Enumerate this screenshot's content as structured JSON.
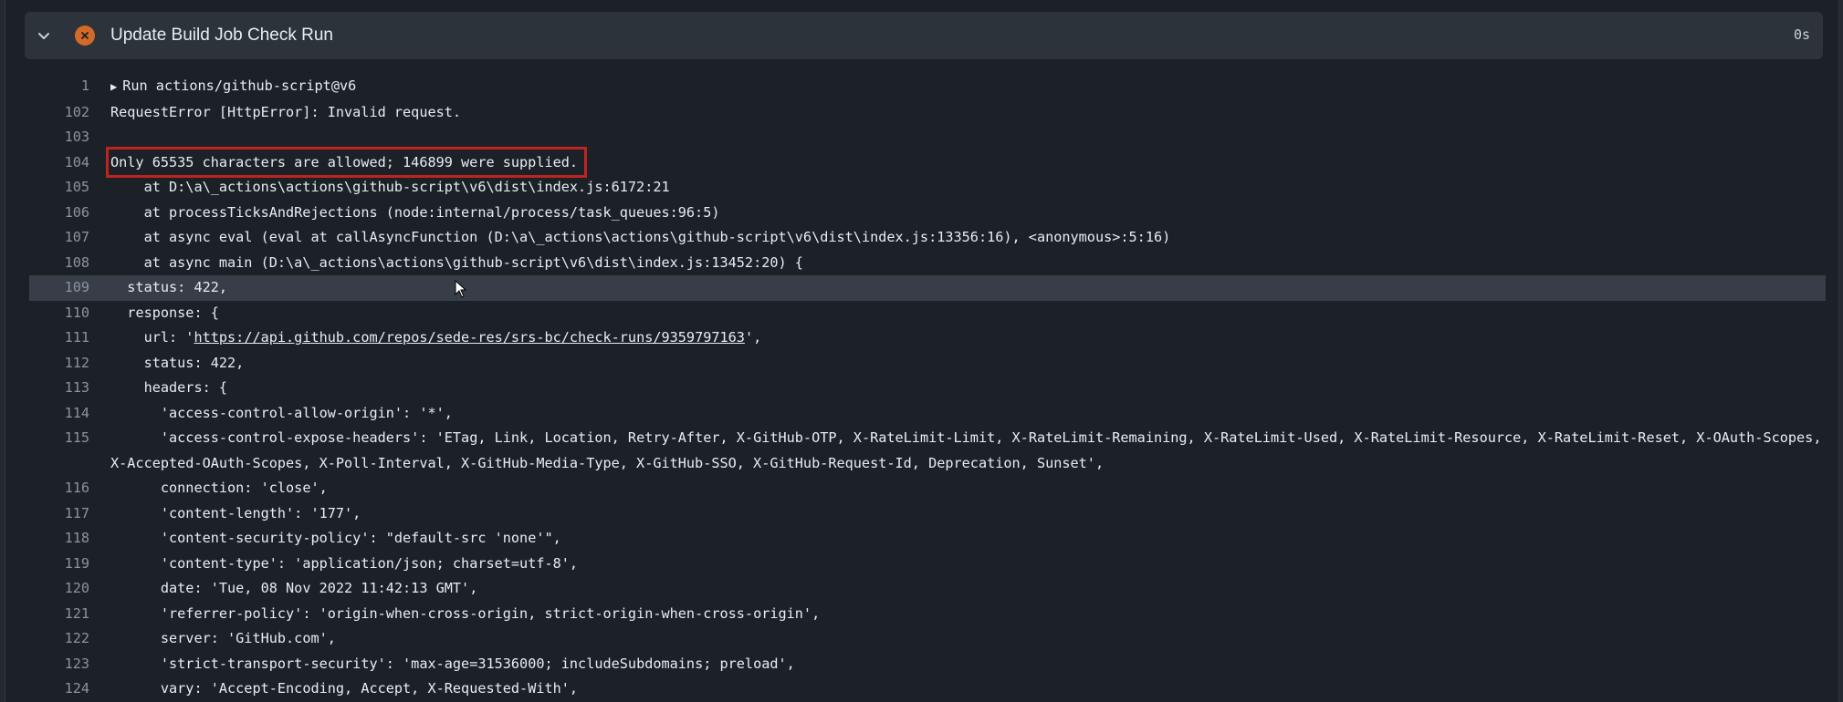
{
  "step": {
    "title": "Update Build Job Check Run",
    "duration": "0s",
    "status_icon": "x-circle-fill-icon",
    "expand_icon": "chevron-down-icon"
  },
  "colors": {
    "background": "#1c2128",
    "header_bg": "#2d333b",
    "fail": "#d46a28",
    "highlight_box": "#c0231f",
    "line_highlight": "#373e47"
  },
  "log": {
    "run_line": {
      "num": "1",
      "text": "Run actions/github-script@v6"
    },
    "lines": [
      {
        "num": "102",
        "text": "RequestError [HttpError]: Invalid request."
      },
      {
        "num": "103",
        "text": ""
      },
      {
        "num": "104",
        "text": "Only 65535 characters are allowed; 146899 were supplied."
      },
      {
        "num": "105",
        "text": "    at D:\\a\\_actions\\actions\\github-script\\v6\\dist\\index.js:6172:21"
      },
      {
        "num": "106",
        "text": "    at processTicksAndRejections (node:internal/process/task_queues:96:5)"
      },
      {
        "num": "107",
        "text": "    at async eval (eval at callAsyncFunction (D:\\a\\_actions\\actions\\github-script\\v6\\dist\\index.js:13356:16), <anonymous>:5:16)"
      },
      {
        "num": "108",
        "text": "    at async main (D:\\a\\_actions\\actions\\github-script\\v6\\dist\\index.js:13452:20) {"
      },
      {
        "num": "109",
        "text": "  status: 422,"
      },
      {
        "num": "110",
        "text": "  response: {"
      },
      {
        "num": "111",
        "prefix": "    url: '",
        "link": "https://api.github.com/repos/sede-res/srs-bc/check-runs/9359797163",
        "suffix": "',"
      },
      {
        "num": "112",
        "text": "    status: 422,"
      },
      {
        "num": "113",
        "text": "    headers: {"
      },
      {
        "num": "114",
        "text": "      'access-control-allow-origin': '*',"
      },
      {
        "num": "115",
        "text": "      'access-control-expose-headers': 'ETag, Link, Location, Retry-After, X-GitHub-OTP, X-RateLimit-Limit, X-RateLimit-Remaining, X-RateLimit-Used, X-RateLimit-Resource, X-RateLimit-Reset, X-OAuth-Scopes, X-Accepted-OAuth-Scopes, X-Poll-Interval, X-GitHub-Media-Type, X-GitHub-SSO, X-GitHub-Request-Id, Deprecation, Sunset',"
      },
      {
        "num": "116",
        "text": "      connection: 'close',"
      },
      {
        "num": "117",
        "text": "      'content-length': '177',"
      },
      {
        "num": "118",
        "text": "      'content-security-policy': \"default-src 'none'\","
      },
      {
        "num": "119",
        "text": "      'content-type': 'application/json; charset=utf-8',"
      },
      {
        "num": "120",
        "text": "      date: 'Tue, 08 Nov 2022 11:42:13 GMT',"
      },
      {
        "num": "121",
        "text": "      'referrer-policy': 'origin-when-cross-origin, strict-origin-when-cross-origin',"
      },
      {
        "num": "122",
        "text": "      server: 'GitHub.com',"
      },
      {
        "num": "123",
        "text": "      'strict-transport-security': 'max-age=31536000; includeSubdomains; preload',"
      },
      {
        "num": "124",
        "text": "      vary: 'Accept-Encoding, Accept, X-Requested-With',"
      }
    ]
  }
}
